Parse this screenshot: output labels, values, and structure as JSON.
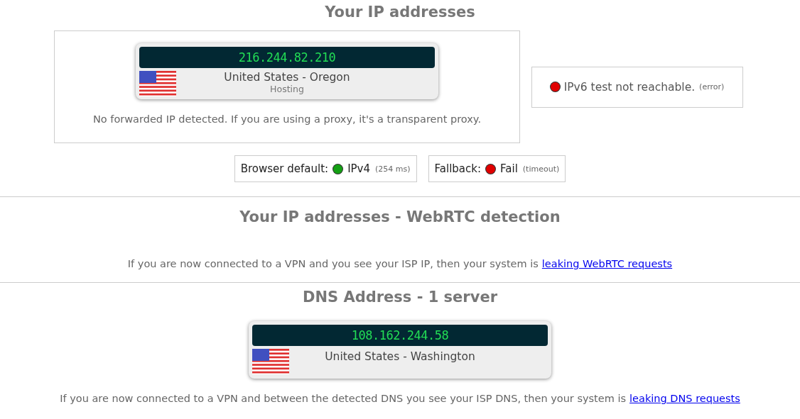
{
  "ip_section": {
    "title": "Your IP addresses",
    "ip_card": {
      "ip": "216.244.82.210",
      "location": "United States - Oregon",
      "type": "Hosting"
    },
    "note": "No forwarded IP detected. If you are using a proxy, it's a transparent proxy.",
    "ipv6": {
      "color": "#e00000",
      "text": "IPv6 test not reachable.",
      "detail": "(error)"
    },
    "protocols": [
      {
        "label": "Browser default:",
        "color": "#14a014",
        "value": "IPv4",
        "detail": "(254 ms)"
      },
      {
        "label": "Fallback:",
        "color": "#e00000",
        "value": "Fail",
        "detail": "(timeout)"
      }
    ]
  },
  "webrtc_section": {
    "title": "Your IP addresses - WebRTC detection",
    "note": "If you are now connected to a VPN and you see your ISP IP, then your system is",
    "link": "leaking WebRTC requests"
  },
  "dns_section": {
    "title": "DNS Address - 1 server",
    "ip_card": {
      "ip": "108.162.244.58",
      "location": "United States - Washington"
    },
    "note": "If you are now connected to a VPN and between the detected DNS you see your ISP DNS, then your system is",
    "link": "leaking DNS requests"
  }
}
